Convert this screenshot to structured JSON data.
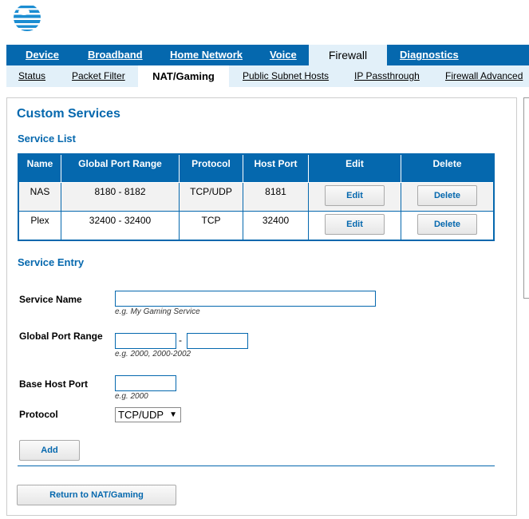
{
  "logo": {
    "icon": "att-globe-icon",
    "color": "#1b8dd2"
  },
  "nav_primary": {
    "items": [
      "Device",
      "Broadband",
      "Home Network",
      "Voice",
      "Firewall",
      "Diagnostics"
    ],
    "active": "Firewall"
  },
  "nav_secondary": {
    "items": [
      "Status",
      "Packet Filter",
      "NAT/Gaming",
      "Public Subnet Hosts",
      "IP Passthrough",
      "Firewall Advanced"
    ],
    "active": "NAT/Gaming"
  },
  "page": {
    "title": "Custom Services",
    "service_list_heading": "Service List",
    "service_entry_heading": "Service Entry"
  },
  "table": {
    "headers": [
      "Name",
      "Global Port Range",
      "Protocol",
      "Host Port",
      "Edit",
      "Delete"
    ],
    "rows": [
      {
        "name": "NAS",
        "range": "8180 - 8182",
        "protocol": "TCP/UDP",
        "host_port": "8181",
        "edit": "Edit",
        "delete": "Delete"
      },
      {
        "name": "Plex",
        "range": "32400 - 32400",
        "protocol": "TCP",
        "host_port": "32400",
        "edit": "Edit",
        "delete": "Delete"
      }
    ]
  },
  "form": {
    "service_name_label": "Service Name",
    "service_name_hint": "e.g. My Gaming Service",
    "service_name_value": "",
    "port_range_label": "Global Port Range",
    "port_range_sep": "-",
    "port_range_hint": "e.g. 2000, 2000-2002",
    "port_start_value": "",
    "port_end_value": "",
    "base_host_port_label": "Base Host Port",
    "base_host_port_hint": "e.g. 2000",
    "base_host_port_value": "",
    "protocol_label": "Protocol",
    "protocol_selected": "TCP/UDP",
    "add_label": "Add",
    "return_label": "Return to NAT/Gaming"
  },
  "colors": {
    "brand": "#0568ae",
    "nav_light": "#e2f0f9"
  }
}
